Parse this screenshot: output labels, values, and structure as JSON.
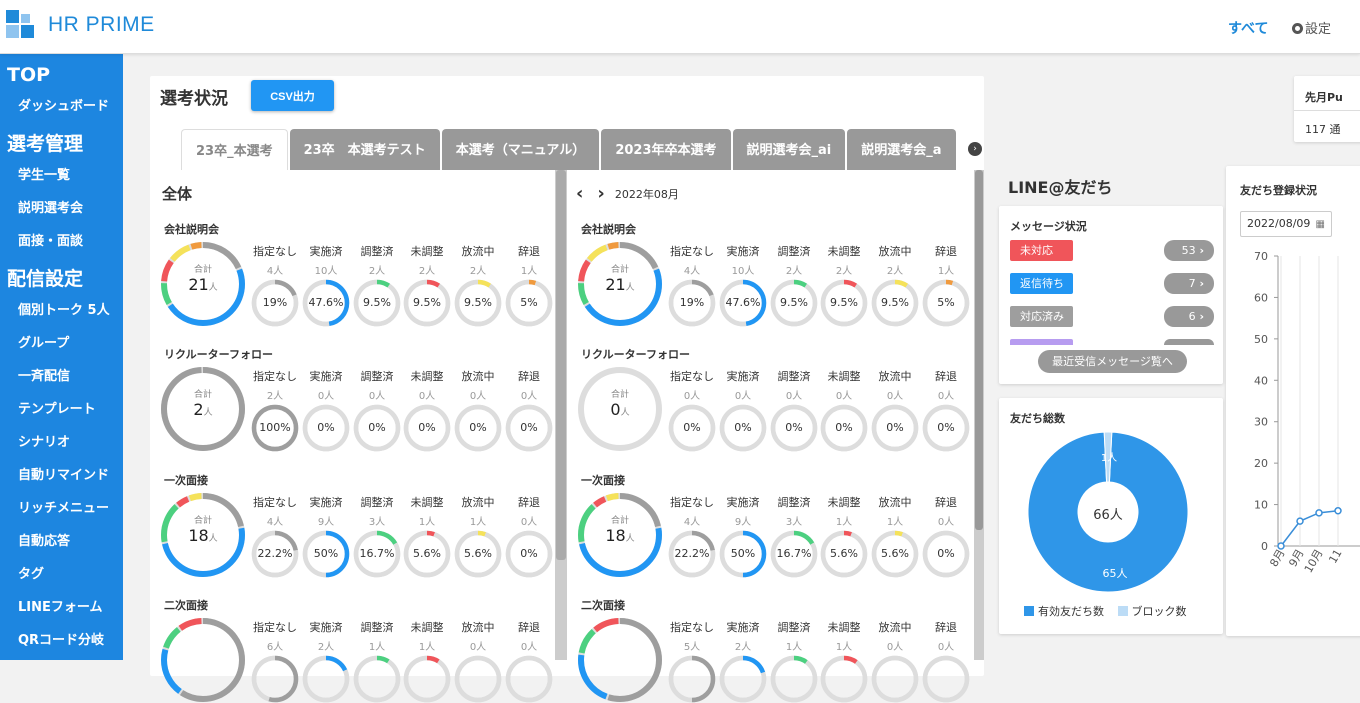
{
  "header": {
    "title": "HR PRIME",
    "nav_all": "すべて",
    "nav_settings": "設定"
  },
  "sidebar": [
    {
      "section": "TOP",
      "items": [
        "ダッシュボード"
      ]
    },
    {
      "section": "選考管理",
      "items": [
        "学生一覧",
        "説明選考会",
        "面接・面談"
      ]
    },
    {
      "section": "配信設定",
      "items": [
        "個別トーク 5人",
        "グループ",
        "一斉配信",
        "テンプレート",
        "シナリオ",
        "自動リマインド",
        "リッチメニュー",
        "自動応答",
        "タグ",
        "LINEフォーム",
        "QRコード分岐"
      ]
    }
  ],
  "selection": {
    "title": "選考状況",
    "csv_button": "CSV出力",
    "tabs": [
      "23卒_本選考",
      "23卒　本選考テスト",
      "本選考（マニュアル）",
      "2023年卒本選考",
      "説明選考会_ai",
      "説明選考会_a"
    ],
    "active_tab": 0,
    "left_title": "全体",
    "month": "2022年08月",
    "total_label": "合計",
    "unit": "人",
    "status_labels": [
      "指定なし",
      "実施済",
      "調整済",
      "未調整",
      "放流中",
      "辞退"
    ],
    "status_colors": [
      "#9e9e9e",
      "#2196f3",
      "#4cd080",
      "#f0555a",
      "#f5e25a",
      "#f09a3e"
    ],
    "left": [
      {
        "title": "会社説明会",
        "total": "21",
        "counts": [
          "4人",
          "10人",
          "2人",
          "2人",
          "2人",
          "1人"
        ],
        "pcts": [
          "19%",
          "47.6%",
          "9.5%",
          "9.5%",
          "9.5%",
          "5%"
        ],
        "values": [
          19,
          47.6,
          9.5,
          9.5,
          9.5,
          5
        ]
      },
      {
        "title": "リクルーターフォロー",
        "total": "2",
        "counts": [
          "2人",
          "0人",
          "0人",
          "0人",
          "0人",
          "0人"
        ],
        "pcts": [
          "100%",
          "0%",
          "0%",
          "0%",
          "0%",
          "0%"
        ],
        "values": [
          100,
          0,
          0,
          0,
          0,
          0
        ]
      },
      {
        "title": "一次面接",
        "total": "18",
        "counts": [
          "4人",
          "9人",
          "3人",
          "1人",
          "1人",
          "0人"
        ],
        "pcts": [
          "22.2%",
          "50%",
          "16.7%",
          "5.6%",
          "5.6%",
          "0%"
        ],
        "values": [
          22.2,
          50,
          16.7,
          5.6,
          5.6,
          0
        ]
      },
      {
        "title": "二次面接",
        "total": "",
        "counts": [
          "6人",
          "2人",
          "1人",
          "1人",
          "0人",
          "0人"
        ],
        "pcts": [],
        "values": [
          54.5,
          18.2,
          9.1,
          9.1,
          0,
          0
        ]
      }
    ],
    "right": [
      {
        "title": "会社説明会",
        "total": "21",
        "counts": [
          "4人",
          "10人",
          "2人",
          "2人",
          "2人",
          "1人"
        ],
        "pcts": [
          "19%",
          "47.6%",
          "9.5%",
          "9.5%",
          "9.5%",
          "5%"
        ],
        "values": [
          19,
          47.6,
          9.5,
          9.5,
          9.5,
          5
        ]
      },
      {
        "title": "リクルーターフォロー",
        "total": "0",
        "counts": [
          "0人",
          "0人",
          "0人",
          "0人",
          "0人",
          "0人"
        ],
        "pcts": [
          "0%",
          "0%",
          "0%",
          "0%",
          "0%",
          "0%"
        ],
        "values": [
          0,
          0,
          0,
          0,
          0,
          0
        ]
      },
      {
        "title": "一次面接",
        "total": "18",
        "counts": [
          "4人",
          "9人",
          "3人",
          "1人",
          "1人",
          "0人"
        ],
        "pcts": [
          "22.2%",
          "50%",
          "16.7%",
          "5.6%",
          "5.6%",
          "0%"
        ],
        "values": [
          22.2,
          50,
          16.7,
          5.6,
          5.6,
          0
        ]
      },
      {
        "title": "二次面接",
        "total": "",
        "counts": [
          "5人",
          "2人",
          "1人",
          "1人",
          "0人",
          "0人"
        ],
        "pcts": [],
        "values": [
          50,
          20,
          10,
          10,
          0,
          0
        ]
      }
    ]
  },
  "line": {
    "title": "LINE@友だち",
    "message_title": "メッセージ状況",
    "messages": [
      {
        "label": "未対応",
        "count": "53",
        "color": "#f0555a"
      },
      {
        "label": "返信待ち",
        "count": "7",
        "color": "#2196f3"
      },
      {
        "label": "対応済み",
        "count": "6",
        "color": "#9e9e9e"
      }
    ],
    "recent_button": "最近受信メッセージ覧へ",
    "friends_title": "友だち総数",
    "friends_total": "66人",
    "friends_active": "65人",
    "friends_blocked": "1人",
    "friends_values": [
      65,
      1
    ],
    "friends_colors": [
      "#2f96e8",
      "#bcdcf6"
    ],
    "legend": [
      "有効友だち数",
      "ブロック数"
    ]
  },
  "registration": {
    "title": "友だち登録状況",
    "date": "2022/08/09"
  },
  "top_card": {
    "title": "先月Pu",
    "value": "117 通"
  },
  "chart_data": {
    "type": "line",
    "title": "友だち登録状況",
    "x": [
      "8月",
      "9月",
      "10月",
      "11"
    ],
    "y_ticks": [
      0,
      10,
      20,
      30,
      40,
      50,
      60,
      70
    ],
    "ylim": [
      0,
      70
    ],
    "series": [
      {
        "values": [
          0,
          6,
          8,
          8.5
        ]
      }
    ],
    "grid": true
  },
  "icons": {
    "logo": "logo-blocks-icon",
    "settings": "gear-icon",
    "next": "chevron-right-icon",
    "calendar": "calendar-icon"
  }
}
